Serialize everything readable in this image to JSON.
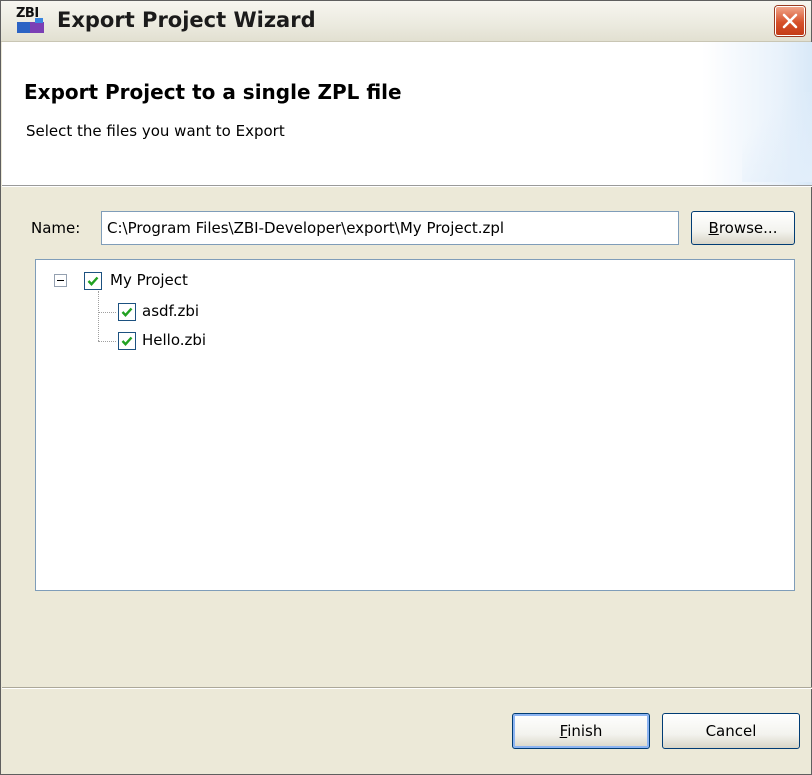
{
  "window": {
    "title": "Export Project Wizard",
    "icon_text": "ZBI"
  },
  "banner": {
    "title": "Export Project to a single ZPL file",
    "subtitle": "Select the files you want to Export"
  },
  "form": {
    "name_label": "Name:",
    "name_value": "C:\\Program Files\\ZBI-Developer\\export\\My Project.zpl",
    "browse_label_prefix": "B",
    "browse_label_rest": "rowse..."
  },
  "tree": {
    "root": {
      "label": "My Project",
      "checked": true,
      "expanded": true
    },
    "children": [
      {
        "label": "asdf.zbi",
        "checked": true
      },
      {
        "label": "Hello.zbi",
        "checked": true
      }
    ]
  },
  "buttons": {
    "finish_prefix": "F",
    "finish_rest": "inish",
    "cancel": "Cancel"
  },
  "colors": {
    "title_close": "#d6512b",
    "check": "#21a121",
    "border_blue": "#7f9db9"
  }
}
